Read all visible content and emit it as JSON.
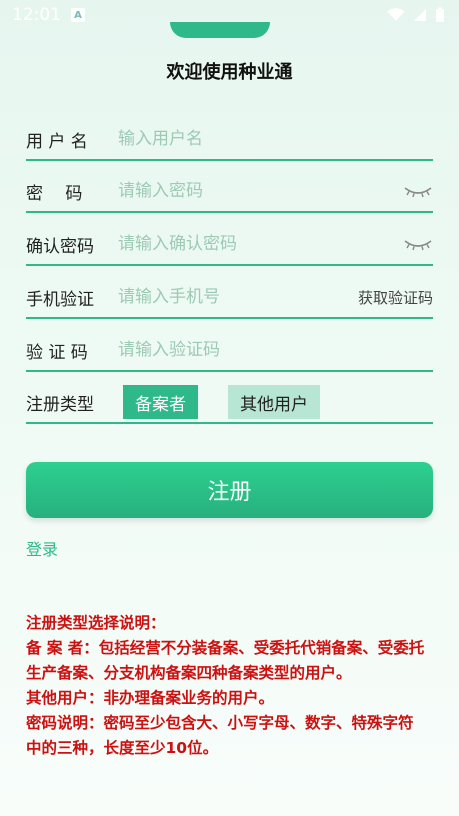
{
  "status_bar": {
    "time": "12:01"
  },
  "page": {
    "title": "欢迎使用种业通"
  },
  "form": {
    "username": {
      "label": "用 户 名",
      "placeholder": "输入用户名"
    },
    "password": {
      "label": "密　 码",
      "placeholder": "请输入密码"
    },
    "confirm_password": {
      "label": "确认密码",
      "placeholder": "请输入确认密码"
    },
    "phone": {
      "label": "手机验证",
      "placeholder": "请输入手机号",
      "get_code": "获取验证码"
    },
    "code": {
      "label": "验 证 码",
      "placeholder": "请输入验证码"
    },
    "register_type": {
      "label": "注册类型",
      "options": [
        "备案者",
        "其他用户"
      ],
      "selected": "备案者"
    }
  },
  "buttons": {
    "register": "注册",
    "login": "登录"
  },
  "notes": [
    "注册类型选择说明：",
    "备 案 者：包括经营不分装备案、受委托代销备案、受委托生产备案、分支机构备案四种备案类型的用户。",
    "其他用户：非办理备案业务的用户。",
    "密码说明：密码至少包含大、小写字母、数字、特殊字符中的三种，长度至少10位。"
  ],
  "colors": {
    "accent": "#2fb98a",
    "note": "#cc1111"
  }
}
